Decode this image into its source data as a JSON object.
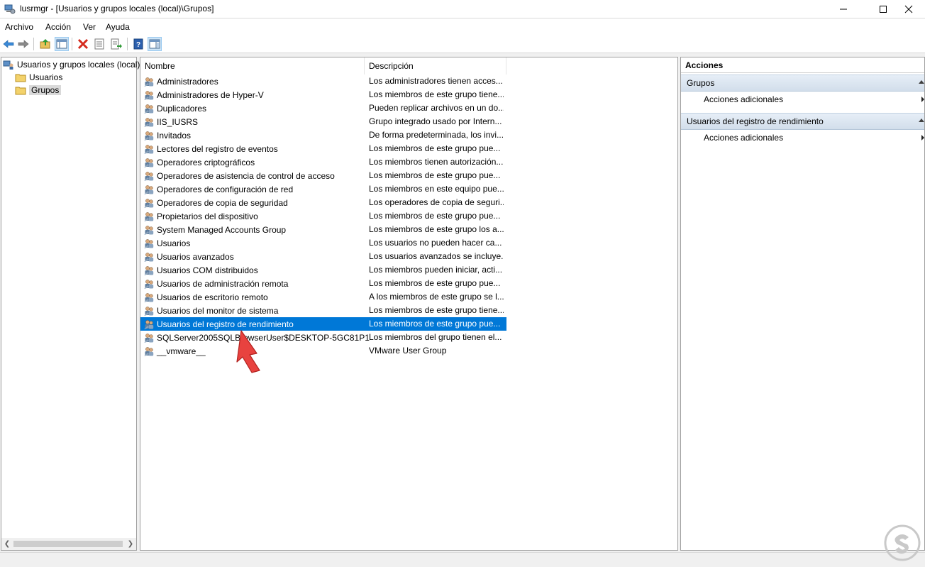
{
  "window": {
    "title": "lusrmgr - [Usuarios y grupos locales (local)\\Grupos]",
    "controls": [
      "minimize-icon",
      "maximize-icon",
      "close-icon"
    ]
  },
  "menubar": {
    "items": [
      "Archivo",
      "Acción",
      "Ver",
      "Ayuda"
    ]
  },
  "toolbar": {
    "buttons": [
      "back-arrow-icon",
      "forward-arrow-icon",
      "up-folder-icon",
      "show-hide-tree-icon",
      "delete-icon",
      "properties-icon",
      "export-list-icon",
      "help-icon",
      "show-hide-action-pane-icon"
    ]
  },
  "tree": {
    "root": "Usuarios y grupos locales (local)",
    "children": [
      "Usuarios",
      "Grupos"
    ],
    "selected": "Grupos"
  },
  "list": {
    "columns": [
      "Nombre",
      "Descripción"
    ],
    "rows": [
      {
        "name": "Administradores",
        "description": "Los administradores tienen acces..."
      },
      {
        "name": "Administradores de Hyper-V",
        "description": "Los miembros de este grupo tiene..."
      },
      {
        "name": "Duplicadores",
        "description": "Pueden replicar archivos en un do..."
      },
      {
        "name": "IIS_IUSRS",
        "description": "Grupo integrado usado por Intern..."
      },
      {
        "name": "Invitados",
        "description": "De forma predeterminada, los invi..."
      },
      {
        "name": "Lectores del registro de eventos",
        "description": "Los miembros de este grupo pue..."
      },
      {
        "name": "Operadores criptográficos",
        "description": "Los miembros tienen autorización..."
      },
      {
        "name": "Operadores de asistencia de control de acceso",
        "description": "Los miembros de este grupo pue..."
      },
      {
        "name": "Operadores de configuración de red",
        "description": "Los miembros en este equipo pue..."
      },
      {
        "name": "Operadores de copia de seguridad",
        "description": "Los operadores de copia de seguri..."
      },
      {
        "name": "Propietarios del dispositivo",
        "description": "Los miembros de este grupo pue..."
      },
      {
        "name": "System Managed Accounts Group",
        "description": "Los miembros de este grupo los a..."
      },
      {
        "name": "Usuarios",
        "description": "Los usuarios no pueden hacer ca..."
      },
      {
        "name": "Usuarios avanzados",
        "description": "Los usuarios avanzados se incluye..."
      },
      {
        "name": "Usuarios COM distribuidos",
        "description": "Los miembros pueden iniciar, acti..."
      },
      {
        "name": "Usuarios de administración remota",
        "description": "Los miembros de este grupo pue..."
      },
      {
        "name": "Usuarios de escritorio remoto",
        "description": "A los miembros de este grupo se l..."
      },
      {
        "name": "Usuarios del monitor de sistema",
        "description": "Los miembros de este grupo tiene..."
      },
      {
        "name": "Usuarios del registro de rendimiento",
        "description": "Los miembros de este grupo pue...",
        "selected": true
      },
      {
        "name": "SQLServer2005SQLBrowserUser$DESKTOP-5GC81P1",
        "description": "Los miembros del grupo tienen el..."
      },
      {
        "name": "__vmware__",
        "description": "VMware User Group"
      }
    ]
  },
  "actions": {
    "header": "Acciones",
    "groups": [
      {
        "title": "Grupos",
        "items": [
          "Acciones adicionales"
        ]
      },
      {
        "title": "Usuarios del registro de rendimiento",
        "items": [
          "Acciones adicionales"
        ]
      }
    ]
  },
  "colors": {
    "selection": "#0078d7",
    "annotation_arrow": "#e8423f",
    "action_group_bg": "#dbe5f1"
  }
}
